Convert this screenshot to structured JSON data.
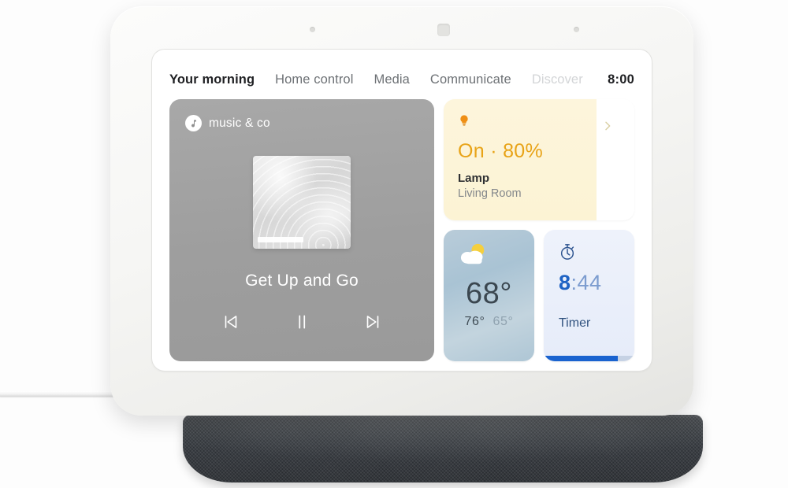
{
  "device": {
    "name": "smart-display",
    "sensors": [
      "microphone-dot-left",
      "ambient-light-sensor",
      "microphone-dot-right"
    ]
  },
  "nav": {
    "tabs": [
      {
        "label": "Your morning",
        "state": "active"
      },
      {
        "label": "Home control",
        "state": "normal"
      },
      {
        "label": "Media",
        "state": "normal"
      },
      {
        "label": "Communicate",
        "state": "normal"
      },
      {
        "label": "Discover",
        "state": "faded"
      }
    ],
    "clock": "8:00"
  },
  "media_card": {
    "provider": "music & co",
    "provider_icon": "music-note-icon",
    "track_title": "Get Up and Go",
    "controls": {
      "previous": "skip-previous-icon",
      "play_pause": "pause-icon",
      "next": "skip-next-icon"
    }
  },
  "lamp_card": {
    "icon": "lightbulb-icon",
    "state": "On · 80%",
    "brightness_percent": 80,
    "name": "Lamp",
    "room": "Living Room",
    "chevron": "chevron-right-icon",
    "accent_color": "#e8a317",
    "fill_color": "#fdf5dc"
  },
  "weather_card": {
    "icon": "partly-cloudy-icon",
    "temperature": "68°",
    "high": "76°",
    "low": "65°"
  },
  "timer_card": {
    "icon": "stopwatch-icon",
    "minutes": "8",
    "seconds": ":44",
    "label": "Timer",
    "progress_percent": 82,
    "accent_color": "#1a63cf"
  }
}
